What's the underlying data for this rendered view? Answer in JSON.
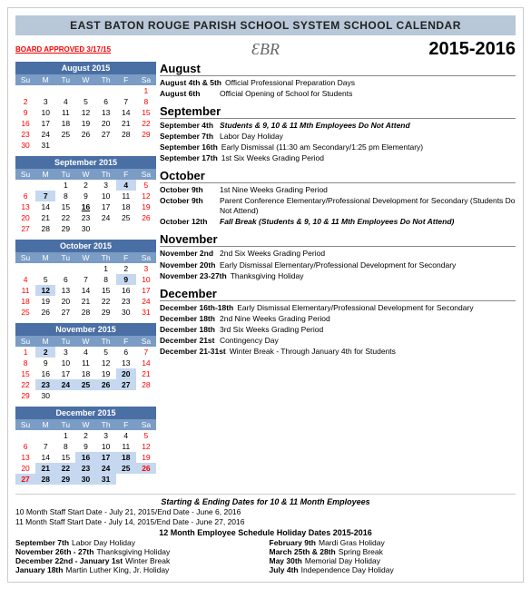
{
  "page": {
    "header": {
      "title": "EAST BATON ROUGE PARISH SCHOOL SYSTEM SCHOOL CALENDAR",
      "year": "2015-2016",
      "board_approved": "BOARD APPROVED 3/17/15",
      "logo": "ƐΒR"
    },
    "months": [
      {
        "name": "August 2015",
        "label": "August",
        "events": [
          {
            "date": "August 4th & 5th",
            "desc": "Official Professional Preparation Days",
            "style": ""
          },
          {
            "date": "August 6th",
            "desc": "Official Opening of School for Students",
            "style": ""
          }
        ]
      },
      {
        "name": "September 2015",
        "label": "September",
        "events": [
          {
            "date": "September 4th",
            "desc": "Students & 9, 10 & 11 Mth Employees Do Not Attend",
            "style": "bold-italic"
          },
          {
            "date": "September 7th",
            "desc": "Labor Day Holiday",
            "style": ""
          },
          {
            "date": "September 16th",
            "desc": "Early Dismissal (11:30 am Secondary/1:25 pm Elementary)",
            "style": ""
          },
          {
            "date": "September 17th",
            "desc": "1st Six Weeks Grading Period",
            "style": ""
          }
        ]
      },
      {
        "name": "October 2015",
        "label": "October",
        "events": [
          {
            "date": "October 9th",
            "desc": "1st Nine Weeks Grading Period",
            "style": ""
          },
          {
            "date": "October 9th",
            "desc": "Parent Conference Elementary/Professional Development for Secondary (Students Do Not Attend)",
            "style": ""
          },
          {
            "date": "October 12th",
            "desc": "Fall Break (Students & 9, 10 & 11 Mth Employees Do Not Attend)",
            "style": "italic"
          }
        ]
      },
      {
        "name": "November 2015",
        "label": "November",
        "events": [
          {
            "date": "November 2nd",
            "desc": "2nd Six Weeks Grading Period",
            "style": ""
          },
          {
            "date": "November 20th",
            "desc": "Early Dismissal Elementary/Professional Development for Secondary",
            "style": ""
          },
          {
            "date": "November 23-27th",
            "desc": "Thanksgiving Holiday",
            "style": ""
          }
        ]
      },
      {
        "name": "December 2015",
        "label": "December",
        "events": [
          {
            "date": "December 16th-18th",
            "desc": "Early Dismissal Elementary/Professional Development for Secondary",
            "style": ""
          },
          {
            "date": "December 18th",
            "desc": "2nd Nine Weeks Grading Period",
            "style": ""
          },
          {
            "date": "December 18th",
            "desc": "3rd Six Weeks Grading Period",
            "style": ""
          },
          {
            "date": "December 21st",
            "desc": "Contingency Day",
            "style": ""
          },
          {
            "date": "December 21-31st",
            "desc": "Winter Break - Through January 4th for Students",
            "style": ""
          }
        ]
      }
    ],
    "footer": {
      "title": "Starting & Ending Dates for 10 & 11 Month Employees",
      "staff": [
        "10 Month Staff  Start Date - July 21, 2015/End Date - June 6, 2016",
        "11 Month Staff  Start Date - July 14, 2015/End Date - June 27, 2016"
      ],
      "holidays_title": "12 Month Employee Schedule Holiday Dates 2015-2016",
      "holidays": [
        {
          "date": "September 7th",
          "name": "Labor Day Holiday"
        },
        {
          "date": "February 9th",
          "name": "Mardi Gras Holiday"
        },
        {
          "date": "November 26th - 27th",
          "name": "Thanksgiving Holiday"
        },
        {
          "date": "March 25th & 28th",
          "name": "Spring Break"
        },
        {
          "date": "December 22nd - January 1st",
          "name": "Winter Break"
        },
        {
          "date": "May 30th",
          "name": "Memorial Day Holiday"
        },
        {
          "date": "January 18th",
          "name": "Martin Luther King, Jr. Holiday"
        },
        {
          "date": "July 4th",
          "name": "Independence Day Holiday"
        }
      ]
    }
  }
}
